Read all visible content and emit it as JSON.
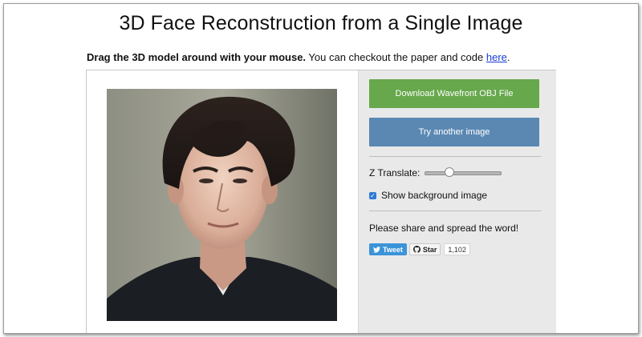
{
  "page": {
    "title": "3D Face Reconstruction from a Single Image",
    "intro_bold": "Drag the 3D model around with your mouse.",
    "intro_rest": " You can checkout the paper and code ",
    "intro_link": "here",
    "intro_end": "."
  },
  "panel": {
    "download_label": "Download Wavefront OBJ File",
    "try_label": "Try another image",
    "z_translate_label": "Z Translate:",
    "z_translate_value": 0.3,
    "show_bg_label": "Show background image",
    "show_bg_checked": true,
    "share_text": "Please share and spread the word!",
    "tweet_label": "Tweet",
    "star_label": "Star",
    "star_count": "1,102"
  },
  "colors": {
    "download": "#67a84c",
    "try": "#5b88b3",
    "panel_bg": "#e9e9e9",
    "tweet": "#3b94d9",
    "link": "#1a3fd6"
  },
  "icons": {
    "tweet": "bird-icon",
    "star": "github-icon",
    "checkbox": "check-icon"
  }
}
